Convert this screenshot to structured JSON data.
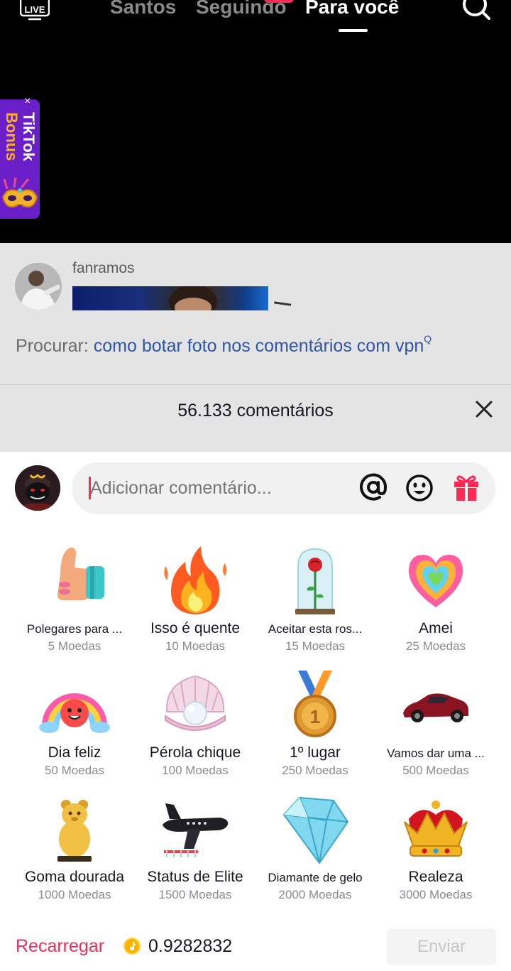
{
  "top_nav": {
    "live_label": "LIVE",
    "tabs": [
      {
        "label": "Santos"
      },
      {
        "label": "Seguindo"
      },
      {
        "label": "Para você"
      }
    ]
  },
  "bonus_banner": {
    "line1": "TikTok",
    "line2": "Bonus",
    "close": "×"
  },
  "preview": {
    "username": "fanramos",
    "search_label": "Procurar:",
    "search_query": "como botar foto nos comentários com vpn",
    "search_suffix": "Q"
  },
  "comments": {
    "count_title": "56.133 comentários",
    "input_placeholder": "Adicionar comentário..."
  },
  "gifts": [
    {
      "name": "Polegares para ...",
      "price": "5 Moedas",
      "icon": "thumbs-up"
    },
    {
      "name": "Isso é quente",
      "price": "10 Moedas",
      "icon": "fire"
    },
    {
      "name": "Aceitar esta ros...",
      "price": "15 Moedas",
      "icon": "rose-dome"
    },
    {
      "name": "Amei",
      "price": "25 Moedas",
      "icon": "rainbow-heart"
    },
    {
      "name": "Dia feliz",
      "price": "50 Moedas",
      "icon": "rainbow-sun"
    },
    {
      "name": "Pérola chique",
      "price": "100 Moedas",
      "icon": "pearl-shell"
    },
    {
      "name": "1º lugar",
      "price": "250 Moedas",
      "icon": "gold-medal"
    },
    {
      "name": "Vamos dar uma ...",
      "price": "500 Moedas",
      "icon": "sports-car"
    },
    {
      "name": "Goma dourada",
      "price": "1000 Moedas",
      "icon": "gummy-bear"
    },
    {
      "name": "Status de Elite",
      "price": "1500 Moedas",
      "icon": "private-jet"
    },
    {
      "name": "Diamante de gelo",
      "price": "2000 Moedas",
      "icon": "ice-diamond"
    },
    {
      "name": "Realeza",
      "price": "3000 Moedas",
      "icon": "crown"
    }
  ],
  "footer": {
    "recharge_label": "Recarregar",
    "balance": "0.9282832",
    "send_label": "Enviar"
  },
  "colors": {
    "accent": "#fe2c55",
    "recharge": "#e0345a",
    "search_link": "#2e56a8"
  }
}
